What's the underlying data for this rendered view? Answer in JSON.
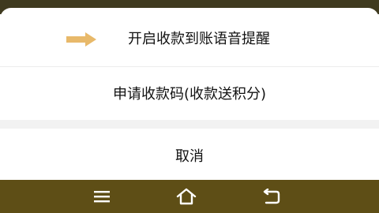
{
  "sheet": {
    "options": [
      {
        "label": "开启收款到账语音提醒",
        "icon": "arrow-right-icon"
      },
      {
        "label": "申请收款码(收款送积分)"
      }
    ],
    "cancel_label": "取消"
  },
  "navbar": {
    "icons": [
      "menu-icon",
      "home-icon",
      "back-icon"
    ]
  },
  "colors": {
    "arrow": "#e8b96a",
    "navbar": "#5e4e16",
    "backdrop": "#3f3a1f",
    "separator": "#f2f2f2"
  }
}
